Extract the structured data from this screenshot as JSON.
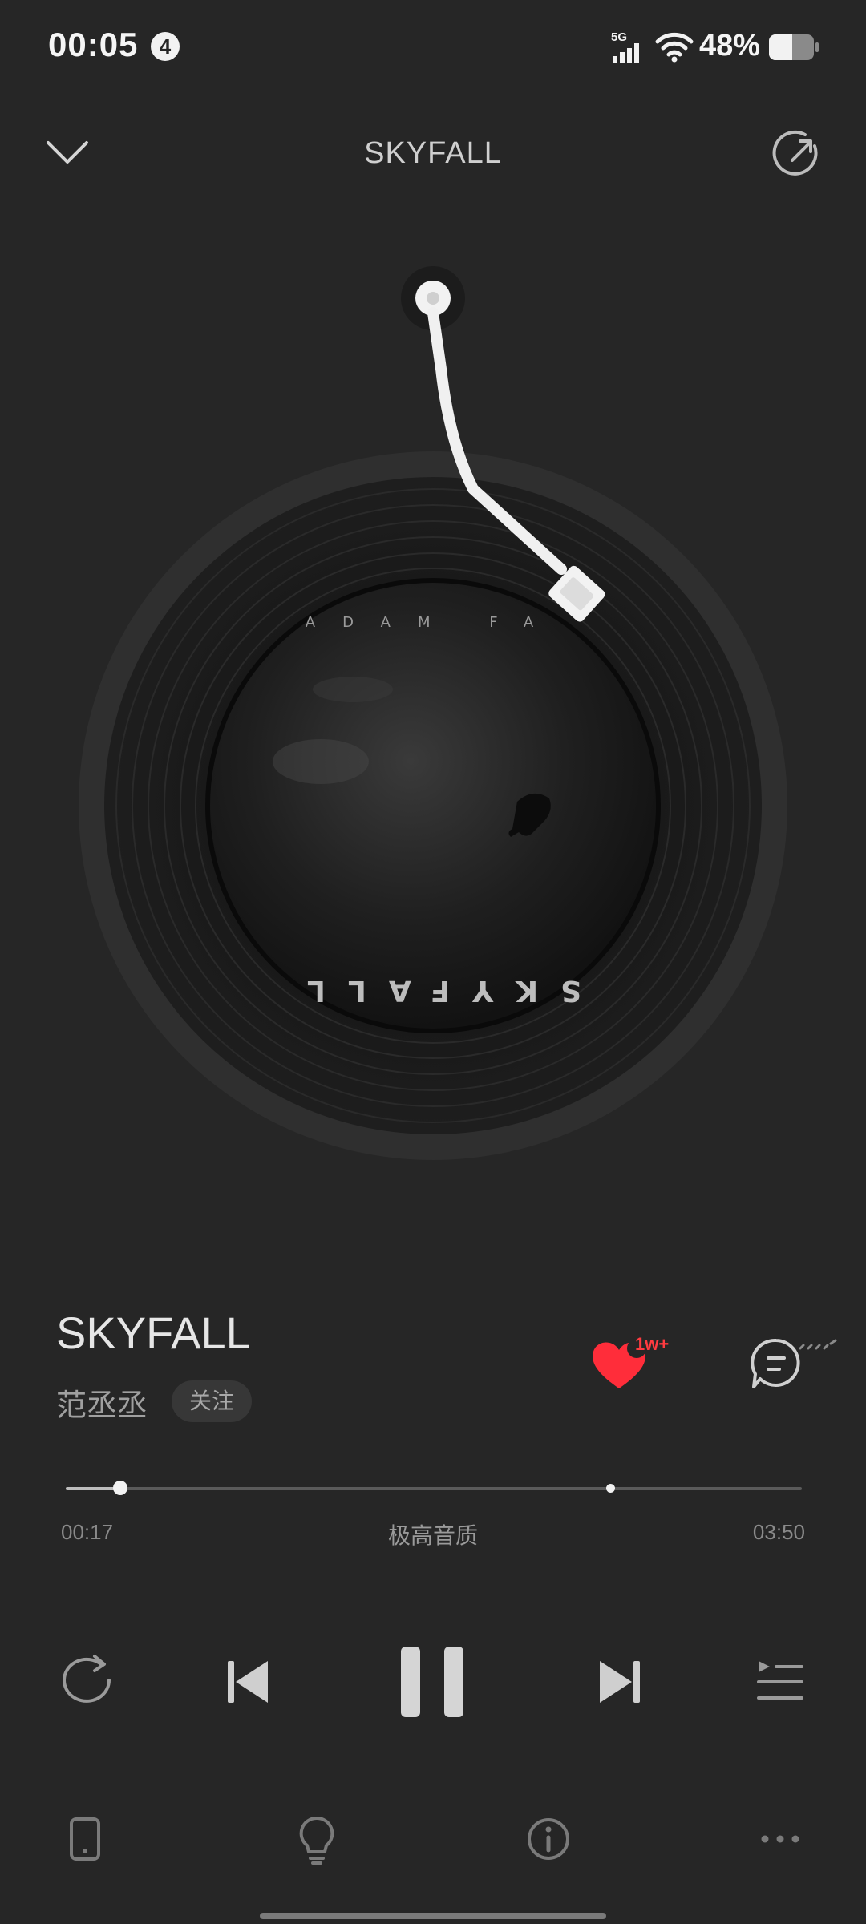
{
  "status_bar": {
    "time": "00:05",
    "notification_count": "4",
    "network_type": "5G",
    "battery_percent": "48%"
  },
  "header": {
    "title": "SKYFALL"
  },
  "album": {
    "top_text": "ADAM FA",
    "bottom_text": "SKYFALL"
  },
  "song": {
    "title": "SKYFALL",
    "artist": "范丞丞",
    "follow_label": "关注",
    "like_count": "1w+"
  },
  "progress": {
    "current_time": "00:17",
    "total_time": "03:50",
    "quality_label": "极高音质",
    "played_fraction": 0.074,
    "buffered_fraction": 0.074,
    "marker_fraction": 0.74
  },
  "colors": {
    "background": "#262626",
    "accent_like": "#ff2d3a",
    "text_primary": "#e6e6e6",
    "text_secondary": "#8a8a8a"
  },
  "icons": {
    "header_left": "chevron-down-icon",
    "header_right": "share-icon",
    "like": "heart-icon",
    "comment": "comment-icon",
    "repeat": "repeat-icon",
    "previous": "previous-icon",
    "pause": "pause-icon",
    "next": "next-icon",
    "playlist": "playlist-icon",
    "device": "phone-device-icon",
    "tips": "lightbulb-icon",
    "info": "info-icon",
    "more": "more-icon"
  }
}
